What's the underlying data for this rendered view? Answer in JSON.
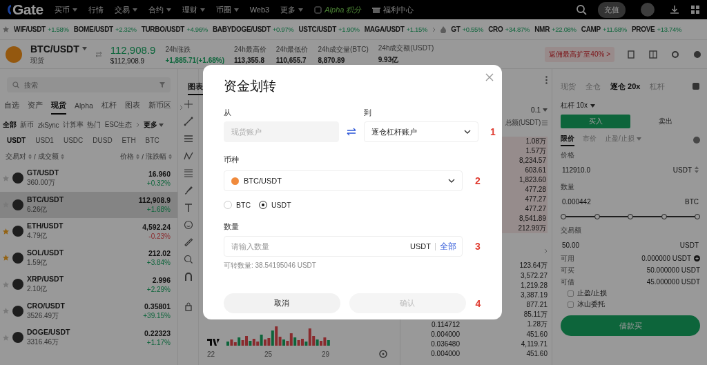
{
  "top_nav": {
    "logo": "Gate",
    "menu": [
      {
        "label": "买币",
        "dropdown": true
      },
      {
        "label": "行情",
        "dropdown": false
      },
      {
        "label": "交易",
        "dropdown": true
      },
      {
        "label": "合约",
        "dropdown": true
      },
      {
        "label": "理财",
        "dropdown": true
      },
      {
        "label": "币圈",
        "dropdown": true
      },
      {
        "label": "Web3",
        "dropdown": false
      },
      {
        "label": "更多",
        "dropdown": true
      }
    ],
    "alpha_label": "Alpha 积分",
    "rewards_label": "福利中心",
    "deposit_button": "充值"
  },
  "ticker": {
    "favorites": [
      {
        "pair": "WIF/USDT",
        "change": "+1.58%"
      },
      {
        "pair": "BOME/USDT",
        "change": "+2.32%"
      },
      {
        "pair": "TURBO/USDT",
        "change": "+4.96%"
      },
      {
        "pair": "BABYDOGE/USDT",
        "change": "+0.97%"
      },
      {
        "pair": "USTC/USDT",
        "change": "+1.90%"
      },
      {
        "pair": "MAGA/USDT",
        "change": "+1.15%"
      }
    ],
    "hot": [
      {
        "pair": "GT",
        "change": "+0.55%"
      },
      {
        "pair": "CRO",
        "change": "+34.87%"
      },
      {
        "pair": "NMR",
        "change": "+22.08%"
      },
      {
        "pair": "CAMP",
        "change": "+11.68%"
      },
      {
        "pair": "PROVE",
        "change": "+13.74%"
      }
    ]
  },
  "pair_header": {
    "pair": "BTC/USDT",
    "market": "现货",
    "price": "112,908.9",
    "price_usd": "$112,908.9",
    "stats": [
      {
        "label": "24h涨跌",
        "value": "+1,885.71(+1.68%)",
        "kind": "change"
      },
      {
        "label": "24h最高价",
        "value": "113,355.8",
        "kind": "plain"
      },
      {
        "label": "24h最低价",
        "value": "110,655.7",
        "kind": "plain"
      },
      {
        "label": "24h成交量(BTC)",
        "value": "8,870.89",
        "kind": "plain"
      },
      {
        "label": "24h成交额(USDT)",
        "value": "9.93亿",
        "kind": "plain"
      }
    ],
    "promo": "返佣最高扩至40% >"
  },
  "market": {
    "search_placeholder": "搜索",
    "tabs": [
      {
        "label": "自选",
        "selected": false
      },
      {
        "label": "资产",
        "selected": false
      },
      {
        "label": "现货",
        "selected": true
      },
      {
        "label": "Alpha",
        "selected": false
      },
      {
        "label": "杠杆",
        "selected": false
      },
      {
        "label": "图表",
        "selected": false
      },
      {
        "label": "新币区",
        "selected": false
      }
    ],
    "filters": [
      {
        "label": "全部",
        "selected": true
      },
      {
        "label": "新币",
        "selected": false
      },
      {
        "label": "zkSync",
        "selected": false
      },
      {
        "label": "计算率",
        "selected": false
      },
      {
        "label": "热门",
        "selected": false
      },
      {
        "label": "ESC生态",
        "selected": false
      }
    ],
    "more_filter": "更多",
    "quotes": [
      {
        "label": "USDT",
        "selected": true
      },
      {
        "label": "USD1",
        "selected": false
      },
      {
        "label": "USDC",
        "selected": false
      },
      {
        "label": "DUSD",
        "selected": false
      },
      {
        "label": "ETH",
        "selected": false
      },
      {
        "label": "BTC",
        "selected": false
      }
    ],
    "columns_left": [
      "交易对",
      "成交额"
    ],
    "columns_right": [
      "价格",
      "涨跌幅"
    ],
    "separator": "/",
    "rows": [
      {
        "pair": "GT/USDT",
        "volume": "360.00万",
        "price": "16.960",
        "change": "+0.32%",
        "kind": "gain",
        "favorite": false,
        "selected": false
      },
      {
        "pair": "BTC/USDT",
        "volume": "6.26亿",
        "price": "112,908.9",
        "change": "+1.68%",
        "kind": "gain",
        "favorite": false,
        "selected": true
      },
      {
        "pair": "ETH/USDT",
        "volume": "4.79亿",
        "price": "4,592.24",
        "change": "-0.23%",
        "kind": "loss",
        "favorite": true,
        "selected": false
      },
      {
        "pair": "SOL/USDT",
        "volume": "1.59亿",
        "price": "212.02",
        "change": "+3.84%",
        "kind": "gain",
        "favorite": true,
        "selected": false
      },
      {
        "pair": "XRP/USDT",
        "volume": "2.10亿",
        "price": "2.996",
        "change": "+2.29%",
        "kind": "gain",
        "favorite": false,
        "selected": false
      },
      {
        "pair": "CRO/USDT",
        "volume": "3526.49万",
        "price": "0.35801",
        "change": "+39.15%",
        "kind": "gain",
        "favorite": false,
        "selected": false
      },
      {
        "pair": "DOGE/USDT",
        "volume": "3316.46万",
        "price": "0.22323",
        "change": "+1.17%",
        "kind": "gain",
        "favorite": false,
        "selected": false
      }
    ]
  },
  "chart": {
    "tab": {
      "label": "图表",
      "selected": true
    },
    "x_labels": [
      "22",
      "25",
      "29"
    ]
  },
  "order_book": {
    "precision": "0.1",
    "total_header": "总额(USDT)",
    "asks": [
      "1.08万",
      "1.57万",
      "8,234.57",
      "603.61",
      "1,823.60",
      "477.28",
      "477.27",
      "477.27",
      "8,541.89",
      "212.99万"
    ],
    "bids": [
      {
        "total": "123.64万"
      },
      {
        "total": "3,572.27"
      },
      {
        "total": "1,219.28"
      },
      {
        "total": "3,387.19"
      },
      {
        "total": "877.21"
      },
      {
        "total": "85.11万"
      },
      {
        "amount": "0.114712",
        "total": "1.28万"
      },
      {
        "amount": "0.004000",
        "total": "451.60"
      },
      {
        "amount": "0.036480",
        "total": "4,119.71"
      },
      {
        "amount": "0.004000",
        "total": "451.60"
      }
    ]
  },
  "trade": {
    "tabs": [
      {
        "label": "现货",
        "selected": false
      },
      {
        "label": "全仓",
        "selected": false
      },
      {
        "label": "逐仓 20x",
        "selected": true
      },
      {
        "label": "杠杆",
        "selected": false
      }
    ],
    "leverage": "杠杆 10x",
    "buy_button": {
      "label": "买入",
      "selected": true
    },
    "sell_button": {
      "label": "卖出",
      "selected": false
    },
    "order_types": [
      {
        "label": "限价",
        "selected": true,
        "dropdown": false
      },
      {
        "label": "市价",
        "selected": false,
        "dropdown": false
      },
      {
        "label": "止盈/止损",
        "selected": false,
        "dropdown": true
      }
    ],
    "fields": [
      {
        "label": "价格",
        "value": "112910.0",
        "unit": "USDT",
        "stepper": true
      },
      {
        "label": "数量",
        "value": "0.000442",
        "unit": "BTC",
        "stepper": false
      }
    ],
    "slider": {
      "level": 1
    },
    "total_field": {
      "label": "交易额",
      "value": "50.00",
      "unit": "USDT"
    },
    "balances": [
      {
        "label": "可用",
        "value": "0.000000 USDT",
        "add": true
      },
      {
        "label": "可买",
        "value": "50.000000 USDT",
        "add": false
      },
      {
        "label": "可借",
        "value": "45.000000 USDT",
        "add": false
      }
    ],
    "options": [
      {
        "label": "止盈/止损",
        "checked": false
      },
      {
        "label": "冰山委托",
        "checked": false
      }
    ],
    "submit_button": "借款买"
  },
  "transfer_dialog": {
    "title": "资金划转",
    "from_label": "从",
    "from_value": "现货账户",
    "from_disabled": true,
    "to_label": "到",
    "to_value": "逐仓杠杆账户",
    "currency_label": "币种",
    "currency_value": "BTC/USDT",
    "assets": [
      {
        "label": "BTC",
        "selected": false
      },
      {
        "label": "USDT",
        "selected": true
      }
    ],
    "amount_label": "数量",
    "amount_placeholder": "请输入数量",
    "amount_unit": "USDT",
    "max_link": "全部",
    "available": "可转数量: 38.54195046 USDT",
    "cancel_button": "取消",
    "confirm_button": {
      "label": "确认",
      "disabled": true
    },
    "step_marks": [
      "1",
      "2",
      "3",
      "4"
    ]
  }
}
